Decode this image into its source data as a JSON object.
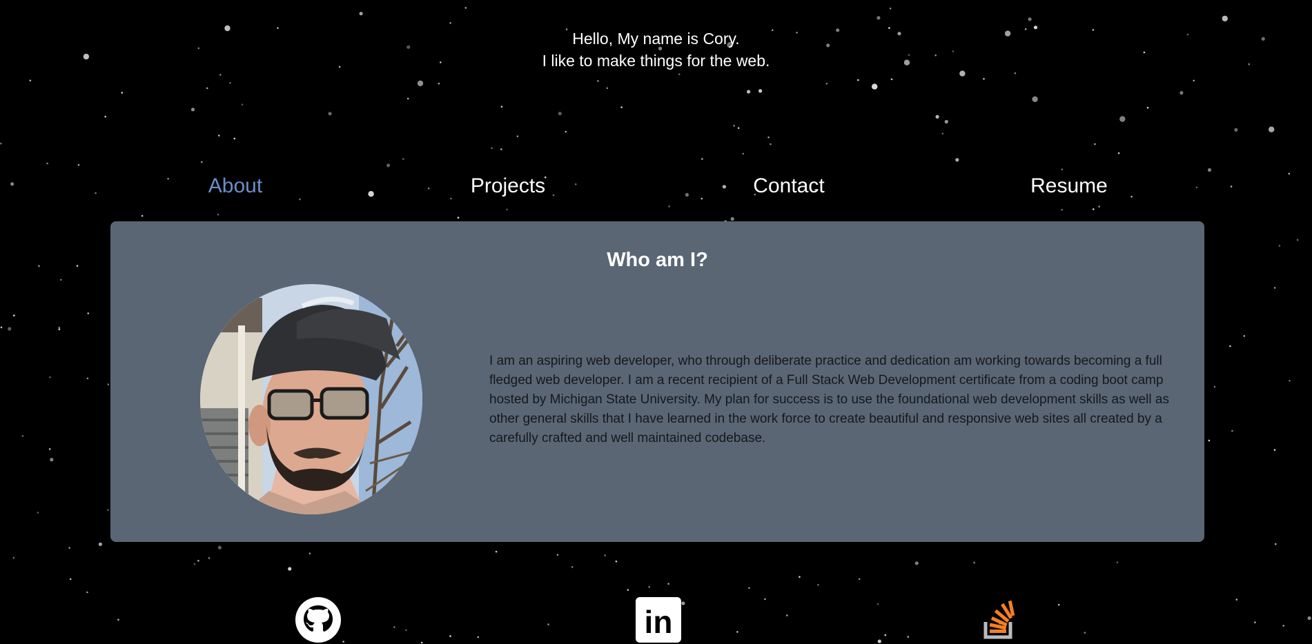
{
  "header": {
    "line1": "Hello, My name is Cory.",
    "line2": "I like to make things for the web."
  },
  "nav": {
    "items": [
      {
        "label": "About",
        "active": true
      },
      {
        "label": "Projects",
        "active": false
      },
      {
        "label": "Contact",
        "active": false
      },
      {
        "label": "Resume",
        "active": false
      }
    ]
  },
  "about": {
    "title": "Who am I?",
    "bio": "I am an aspiring web developer, who through deliberate practice and dedication am working towards becoming a full fledged web developer. I am a recent recipient of a Full Stack Web Development certificate from a coding boot camp hosted by Michigan State University. My plan for success is to use the foundational web development skills as well as other general skills that I have learned in the work force to create beautiful and responsive web sites all created by a carefully crafted and well maintained codebase.",
    "photo": "profile-photo"
  },
  "social": {
    "github_icon": "github-icon",
    "linkedin_icon": "linkedin-icon",
    "linkedin_text": "in",
    "stackoverflow_icon": "stackoverflow-icon"
  },
  "colors": {
    "background": "#000000",
    "nav_active": "#6b8fc9",
    "card_background": "#5a6674",
    "stackoverflow_orange": "#f48024"
  }
}
